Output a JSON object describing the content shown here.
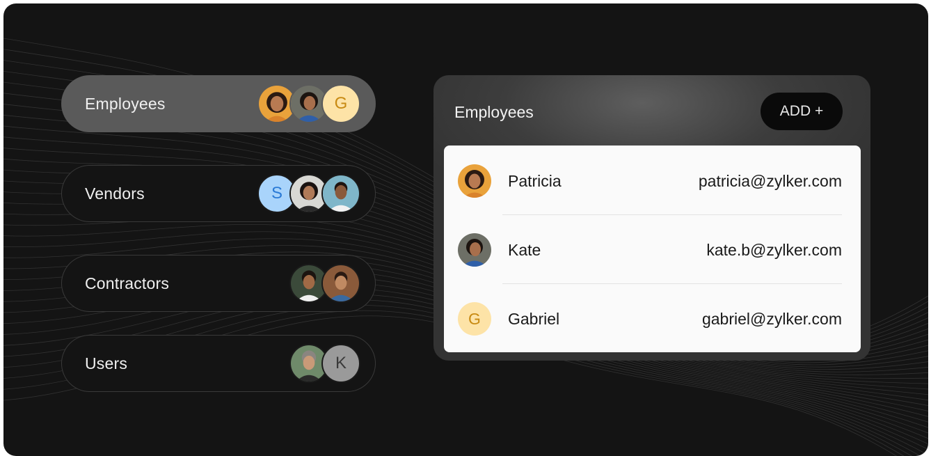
{
  "categories": [
    {
      "label": "Employees",
      "avatars": [
        "photo-woman-orange",
        "photo-woman-blue",
        "G"
      ]
    },
    {
      "label": "Vendors",
      "avatars": [
        "S",
        "photo-woman-grey",
        "photo-man-teal"
      ]
    },
    {
      "label": "Contractors",
      "avatars": [
        "photo-man-beard",
        "photo-man-smile"
      ]
    },
    {
      "label": "Users",
      "avatars": [
        "photo-man-grey",
        "K"
      ]
    }
  ],
  "panel": {
    "title": "Employees",
    "add_label": "ADD +",
    "rows": [
      {
        "name": "Patricia",
        "email": "patricia@zylker.com",
        "avatar": "photo-woman-orange"
      },
      {
        "name": "Kate",
        "email": "kate.b@zylker.com",
        "avatar": "photo-woman-blue"
      },
      {
        "name": "Gabriel",
        "email": "gabriel@zylker.com",
        "avatar": "G"
      }
    ]
  },
  "colors": {
    "background": "#141414",
    "active_pill": "#5a5a5a",
    "accent_g": "#fde3a7",
    "accent_s": "#a9d4fb",
    "accent_k": "#9a9a9a"
  }
}
